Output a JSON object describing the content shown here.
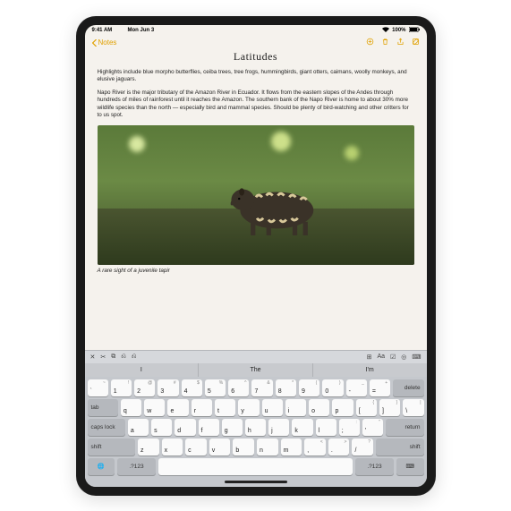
{
  "status": {
    "time": "9:41 AM",
    "date": "Mon Jun 3",
    "battery": "100%"
  },
  "nav": {
    "back": "Notes",
    "icons": [
      "attach-icon",
      "trash-icon",
      "share-icon",
      "compose-icon"
    ]
  },
  "note": {
    "title": "Latitudes",
    "para1": "Highlights include blue morpho butterflies, ceiba trees, tree frogs, hummingbirds, giant otters, caimans, woolly monkeys, and elusive jaguars.",
    "para2": "Napo River is the major tributary of the Amazon River in Ecuador. It flows from the eastern slopes of the Andes through hundreds of miles of rainforest until it reaches the Amazon. The southern bank of the Napo River is home to about 30% more wildlife species than the north — especially bird and mammal species. Should be plenty of bird-watching and other critters for to us spot.",
    "caption": "A rare sight of a juvenile tapir"
  },
  "toolbar": {
    "left": [
      "✕",
      "✂",
      "⧉",
      "⎌",
      "⎌"
    ],
    "right": [
      "⊞",
      "Aa",
      "☑",
      "◎",
      "⌨"
    ]
  },
  "suggestions": [
    "I",
    "The",
    "I'm"
  ],
  "keyboard": {
    "row0": [
      {
        "k": "`",
        "s": "~"
      },
      {
        "k": "1",
        "s": "!"
      },
      {
        "k": "2",
        "s": "@"
      },
      {
        "k": "3",
        "s": "#"
      },
      {
        "k": "4",
        "s": "$"
      },
      {
        "k": "5",
        "s": "%"
      },
      {
        "k": "6",
        "s": "^"
      },
      {
        "k": "7",
        "s": "&"
      },
      {
        "k": "8",
        "s": "*"
      },
      {
        "k": "9",
        "s": "("
      },
      {
        "k": "0",
        "s": ")"
      },
      {
        "k": "-",
        "s": "_"
      },
      {
        "k": "=",
        "s": "+"
      }
    ],
    "row1": [
      "q",
      "w",
      "e",
      "r",
      "t",
      "y",
      "u",
      "i",
      "o",
      "p"
    ],
    "row1_extra": [
      {
        "k": "[",
        "s": "{"
      },
      {
        "k": "]",
        "s": "}"
      },
      {
        "k": "\\",
        "s": "|"
      }
    ],
    "row2": [
      "a",
      "s",
      "d",
      "f",
      "g",
      "h",
      "j",
      "k",
      "l"
    ],
    "row2_extra": [
      {
        "k": ";",
        "s": ":"
      },
      {
        "k": "'",
        "s": "\""
      }
    ],
    "row3": [
      "z",
      "x",
      "c",
      "v",
      "b",
      "n",
      "m"
    ],
    "row3_extra": [
      {
        "k": ",",
        "s": "<"
      },
      {
        "k": ".",
        "s": ">"
      },
      {
        "k": "/",
        "s": "?"
      }
    ],
    "mods": {
      "delete": "delete",
      "tab": "tab",
      "caps": "caps lock",
      "return": "return",
      "shift": "shift",
      "globe": "🌐",
      "hide": "⌨",
      ".?123": ".?123"
    }
  }
}
